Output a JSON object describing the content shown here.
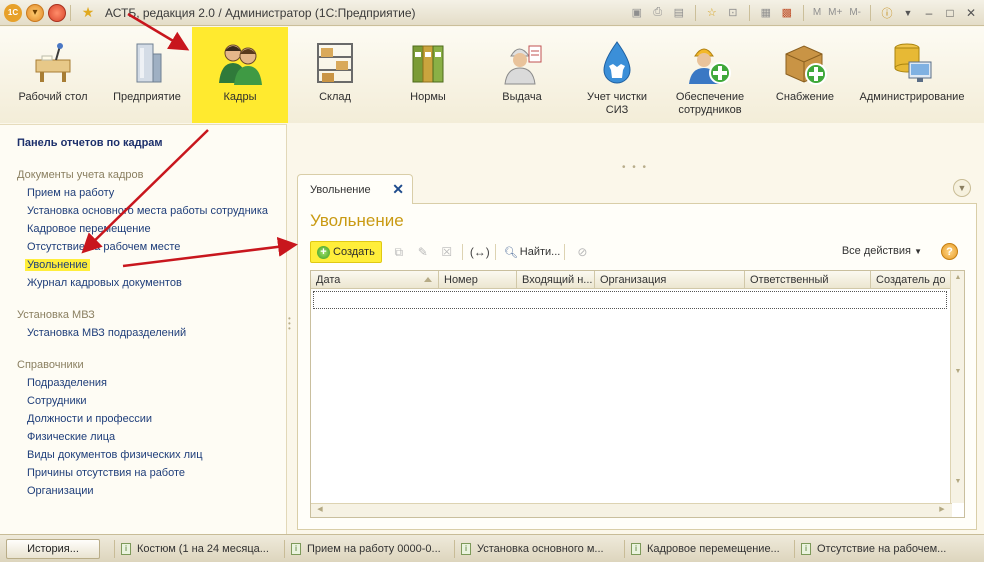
{
  "window": {
    "title": "АСТБ, редакция 2.0 / Администратор  (1С:Предприятие)",
    "tools": [
      "M",
      "M+",
      "M-"
    ]
  },
  "sections": [
    {
      "label": "Рабочий стол",
      "icon": "desk-icon"
    },
    {
      "label": "Предприятие",
      "icon": "building-icon"
    },
    {
      "label": "Кадры",
      "icon": "people-icon"
    },
    {
      "label": "Склад",
      "icon": "warehouse-icon"
    },
    {
      "label": "Нормы",
      "icon": "binders-icon"
    },
    {
      "label": "Выдача",
      "icon": "worker-icon"
    },
    {
      "label": "Учет чистки СИЗ",
      "icon": "cleaning-icon"
    },
    {
      "label": "Обеспечение сотрудников",
      "icon": "worker-add-icon"
    },
    {
      "label": "Снабжение",
      "icon": "box-add-icon"
    },
    {
      "label": "Администрирование",
      "icon": "admin-icon"
    }
  ],
  "leftpanel": {
    "title": "Панель отчетов по кадрам",
    "groups": [
      {
        "title": "Документы учета кадров",
        "items": [
          "Прием на работу",
          "Установка основного места работы сотрудника",
          "Кадровое перемещение",
          "Отсутствие на рабочем месте",
          "Увольнение",
          "Журнал кадровых документов"
        ]
      },
      {
        "title": "Установка МВЗ",
        "items": [
          "Установка МВЗ подразделений"
        ]
      },
      {
        "title": "Справочники",
        "items": [
          "Подразделения",
          "Сотрудники",
          "Должности и профессии",
          "Физические лица",
          "Виды документов физических лиц",
          "Причины отсутствия на работе",
          "Организации"
        ]
      }
    ]
  },
  "tab": {
    "label": "Увольнение"
  },
  "form": {
    "title": "Увольнение",
    "create_label": "Создать",
    "find_label": "Найти...",
    "all_actions_label": "Все действия",
    "columns": [
      "Дата",
      "Номер",
      "Входящий н...",
      "Организация",
      "Ответственный",
      "Создатель до"
    ]
  },
  "statusbar": {
    "history_label": "История...",
    "open_windows": [
      "Костюм (1 на 24 месяца...",
      "Прием на работу 0000-0...",
      "Установка основного м...",
      "Кадровое перемещение...",
      "Отсутствие на рабочем..."
    ]
  },
  "colors": {
    "accent_yellow": "#ffea2f",
    "annotation_red": "#c8161d",
    "link_blue": "#1f3e7a",
    "title_gold": "#c99a13"
  }
}
